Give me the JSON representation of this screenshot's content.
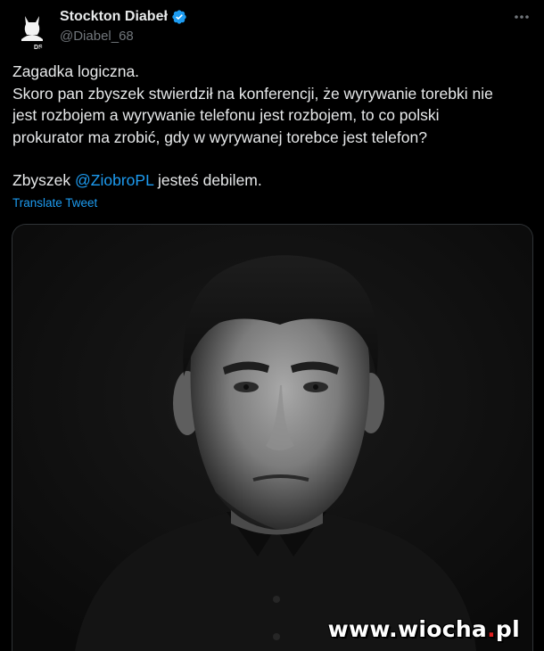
{
  "author": {
    "display_name": "Stockton Diabeł",
    "handle": "@Diabel_68",
    "avatar_text": "DS",
    "verified": true
  },
  "tweet": {
    "lines": [
      "Zagadka logiczna.",
      "Skoro pan zbyszek stwierdził na konferencji, że wyrywanie torebki nie",
      "jest rozbojem a wyrywanie telefonu jest rozbojem, to co polski",
      "prokurator ma zrobić, gdy w wyrywanej torebce jest telefon?"
    ],
    "closing_prefix": "Zbyszek ",
    "mention": "@ZiobroPL",
    "closing_suffix": " jesteś debilem.",
    "translate_label": "Translate Tweet"
  },
  "media": {
    "watermark_prefix": "www.",
    "watermark_main": "wiocha",
    "watermark_dot": ".",
    "watermark_suffix": "pl"
  },
  "icons": {
    "verified": "verified-badge-icon",
    "more": "more-icon"
  },
  "colors": {
    "background": "#000000",
    "text": "#e7e9ea",
    "secondary_text": "#71767b",
    "link": "#1d9bf0",
    "verified": "#1d9bf0",
    "watermark_accent": "#e02020"
  }
}
